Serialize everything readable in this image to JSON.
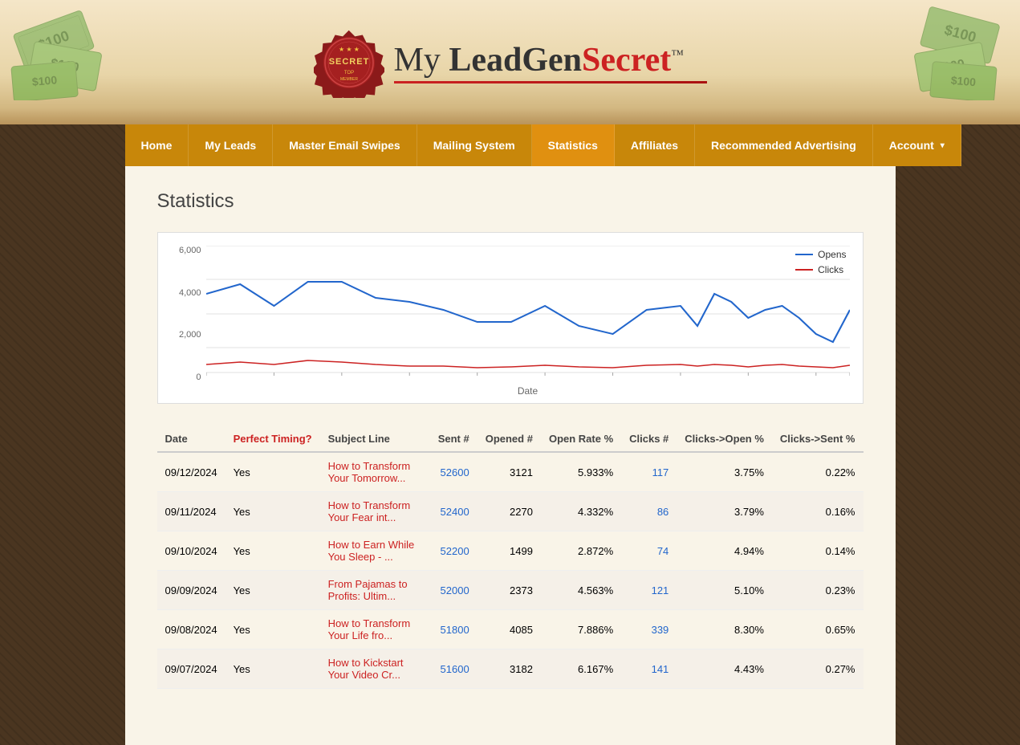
{
  "brand": {
    "name_part1": "My ",
    "name_part2": "LeadGen",
    "name_part3": "Secret",
    "tm": "™"
  },
  "nav": {
    "items": [
      {
        "label": "Home",
        "id": "home",
        "active": false
      },
      {
        "label": "My Leads",
        "id": "my-leads",
        "active": false
      },
      {
        "label": "Master Email Swipes",
        "id": "master-email-swipes",
        "active": false
      },
      {
        "label": "Mailing System",
        "id": "mailing-system",
        "active": false
      },
      {
        "label": "Statistics",
        "id": "statistics",
        "active": true
      },
      {
        "label": "Affiliates",
        "id": "affiliates",
        "active": false
      },
      {
        "label": "Recommended Advertising",
        "id": "recommended-advertising",
        "active": false
      },
      {
        "label": "Account",
        "id": "account",
        "active": false,
        "hasDropdown": true
      }
    ]
  },
  "page": {
    "title": "Statistics"
  },
  "chart": {
    "y_labels": [
      "6,000",
      "4,000",
      "2,000",
      "0"
    ],
    "x_label": "Date",
    "legend": {
      "opens_label": "Opens",
      "clicks_label": "Clicks"
    }
  },
  "table": {
    "headers": [
      "Date",
      "Perfect Timing?",
      "Subject Line",
      "Sent #",
      "Opened #",
      "Open Rate %",
      "Clicks #",
      "Clicks->Open %",
      "Clicks->Sent %"
    ],
    "rows": [
      {
        "date": "09/12/2024",
        "perfect_timing": "Yes",
        "subject": "How to Transform Your Tomorrow...",
        "sent": "52600",
        "opened": "3121",
        "open_rate": "5.933%",
        "clicks": "117",
        "clicks_open": "3.75%",
        "clicks_sent": "0.22%"
      },
      {
        "date": "09/11/2024",
        "perfect_timing": "Yes",
        "subject": "How to Transform Your Fear int...",
        "sent": "52400",
        "opened": "2270",
        "open_rate": "4.332%",
        "clicks": "86",
        "clicks_open": "3.79%",
        "clicks_sent": "0.16%"
      },
      {
        "date": "09/10/2024",
        "perfect_timing": "Yes",
        "subject": "How to Earn While You Sleep - ...",
        "sent": "52200",
        "opened": "1499",
        "open_rate": "2.872%",
        "clicks": "74",
        "clicks_open": "4.94%",
        "clicks_sent": "0.14%"
      },
      {
        "date": "09/09/2024",
        "perfect_timing": "Yes",
        "subject": "From Pajamas to Profits: Ultim...",
        "sent": "52000",
        "opened": "2373",
        "open_rate": "4.563%",
        "clicks": "121",
        "clicks_open": "5.10%",
        "clicks_sent": "0.23%"
      },
      {
        "date": "09/08/2024",
        "perfect_timing": "Yes",
        "subject": "How to Transform Your Life fro...",
        "sent": "51800",
        "opened": "4085",
        "open_rate": "7.886%",
        "clicks": "339",
        "clicks_open": "8.30%",
        "clicks_sent": "0.65%"
      },
      {
        "date": "09/07/2024",
        "perfect_timing": "Yes",
        "subject": "How to Kickstart Your Video Cr...",
        "sent": "51600",
        "opened": "3182",
        "open_rate": "6.167%",
        "clicks": "141",
        "clicks_open": "4.43%",
        "clicks_sent": "0.27%"
      }
    ]
  }
}
